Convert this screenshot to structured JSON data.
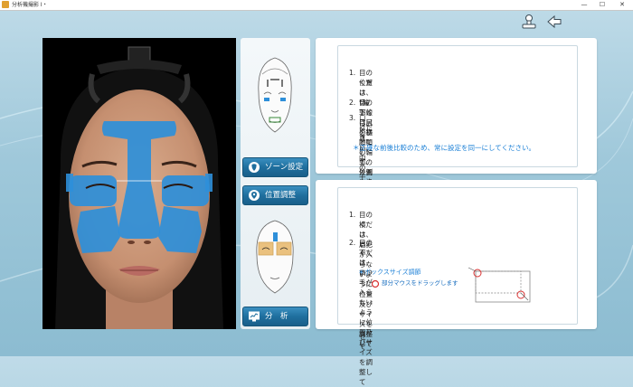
{
  "titlebar": {
    "title": "分析機撮影 I・",
    "min": "—",
    "max": "☐",
    "close": "✕"
  },
  "sidebar": {
    "zone_button": "ゾーン設定",
    "position_button": "位置調整",
    "analyze_button": "分　析"
  },
  "card1": {
    "items": [
      {
        "num": "1.",
        "lines": [
          "目の位置は、目の下と目尻を基順にして、位置を設定して",
          "ください。"
        ]
      },
      {
        "num": "2.",
        "lines": [
          "*輪郭線は目の横と顎の輪郭の外側に合わせてください。"
        ]
      },
      {
        "num": "3.",
        "lines": [
          "口は真ん中の十字部分を上唇と下唇の中心に合わせて",
          "ください。"
        ]
      }
    ],
    "note": "＊正確な前後比較のため、常に設定を同一にしてください。"
  },
  "card2": {
    "items": [
      {
        "num": "1.",
        "lines": [
          "目の横は、眉毛が入らないように位置及びサイズを調整して",
          "ください。"
        ]
      },
      {
        "num": "2.",
        "lines": [
          "目の下は、まつ毛が入らないように位置及びサイズを調整して",
          "ください。"
        ]
      }
    ],
    "box_title": "＊ボックスサイズ調節",
    "box_sub": "部分マウスをドラッグします"
  },
  "colors": {
    "accent": "#1f6f9e",
    "note_blue": "#1a7fd6",
    "zone_blue": "#2e8fd9",
    "circle_red": "#d83030"
  },
  "icons": {
    "user": "stamp-icon",
    "back": "back-arrow-icon"
  }
}
